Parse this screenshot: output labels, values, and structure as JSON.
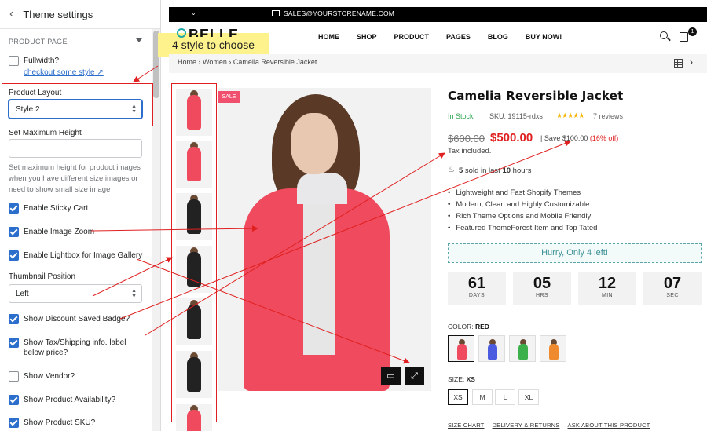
{
  "sidebar": {
    "back_icon": "chevron-left-icon",
    "title": "Theme settings",
    "section_title": "PRODUCT PAGE",
    "fullwidth_label": "Fullwidth?",
    "checkout_link": "checkout some style",
    "product_layout_label": "Product Layout",
    "product_layout_value": "Style 2",
    "max_height_label": "Set Maximum Height",
    "max_height_help": "Set maximum height for product images when you have different size images or need to show small size image",
    "thumb_position_label": "Thumbnail Position",
    "thumb_position_value": "Left",
    "checkboxes": [
      {
        "label": "Enable Sticky Cart",
        "checked": true
      },
      {
        "label": "Enable Image Zoom",
        "checked": true
      },
      {
        "label": "Enable Lightbox for Image Gallery",
        "checked": true
      },
      {
        "label": "Show Discount Saved Badge?",
        "checked": true
      },
      {
        "label": "Show Tax/Shipping info. label below price?",
        "checked": true
      },
      {
        "label": "Show Vendor?",
        "checked": false
      },
      {
        "label": "Show Product Availability?",
        "checked": true
      },
      {
        "label": "Show Product SKU?",
        "checked": true
      }
    ]
  },
  "callout": "4 style to choose",
  "store": {
    "topbar_email": "SALES@YOURSTORENAME.COM",
    "logo": "BELLE",
    "nav": [
      "HOME",
      "SHOP",
      "PRODUCT",
      "PAGES",
      "BLOG",
      "BUY NOW!"
    ],
    "cart_count": "1",
    "breadcrumb": "Home  ›  Women  ›  Camelia Reversible Jacket",
    "sale_badge": "SALE",
    "product": {
      "title": "Camelia Reversible Jacket",
      "stock": "In Stock",
      "sku": "SKU: 19115-rdxs",
      "stars": "★★★★★",
      "reviews": "7 reviews",
      "old_price": "$600.00",
      "new_price": "$500.00",
      "save_text": "| Save $100.00",
      "save_pct": "(16% off)",
      "tax": "Tax included.",
      "sold_count": "5",
      "sold_mid": " sold in last ",
      "sold_hours": "10",
      "sold_end": " hours",
      "features": [
        "Lightweight and Fast Shopify Themes",
        "Modern, Clean and Highly Customizable",
        "Rich Theme Options and Mobile Friendly",
        "Featured ThemeForest Item and Top Tated"
      ],
      "hurry": "Hurry, Only 4 left!",
      "countdown": [
        {
          "num": "61",
          "unit": "DAYS"
        },
        {
          "num": "05",
          "unit": "HRS"
        },
        {
          "num": "12",
          "unit": "MIN"
        },
        {
          "num": "07",
          "unit": "SEC"
        }
      ],
      "color_label": "COLOR:",
      "color_value": "RED",
      "swatches": [
        "#ef4a5e",
        "#4a5be0",
        "#3cb04a",
        "#f08a2e"
      ],
      "size_label": "SIZE:",
      "size_value": "XS",
      "sizes": [
        "XS",
        "M",
        "L",
        "XL"
      ],
      "links": [
        "SIZE CHART",
        "DELIVERY & RETURNS",
        "ASK ABOUT THIS PRODUCT"
      ]
    }
  },
  "colors": {
    "accent": "#2c6ecb",
    "sale": "#e02020",
    "annotation": "#e02020"
  }
}
